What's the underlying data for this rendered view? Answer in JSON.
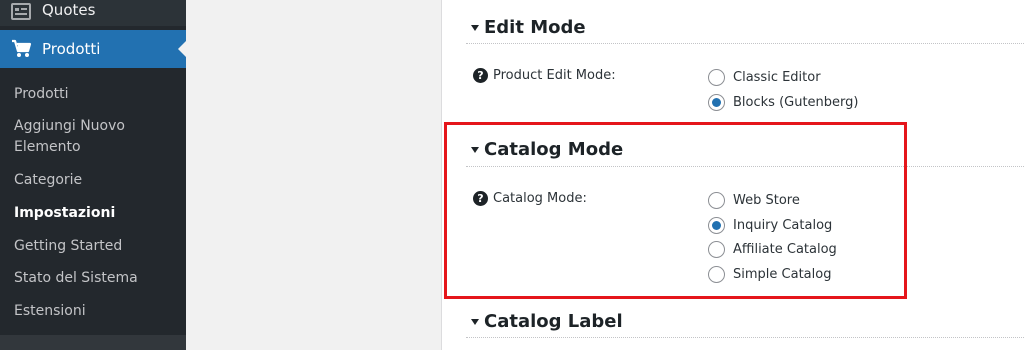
{
  "sidebar": {
    "quotes_label": "Quotes",
    "prodotti_label": "Prodotti",
    "submenu": [
      {
        "label": "Prodotti",
        "current": false
      },
      {
        "label": "Aggiungi Nuovo\nElemento",
        "current": false
      },
      {
        "label": "Categorie",
        "current": false
      },
      {
        "label": "Impostazioni",
        "current": true
      },
      {
        "label": "Getting Started",
        "current": false
      },
      {
        "label": "Stato del Sistema",
        "current": false
      },
      {
        "label": "Estensioni",
        "current": false
      }
    ]
  },
  "sections": {
    "edit_mode": {
      "title": "Edit Mode",
      "field_label": "Product Edit Mode:",
      "options": [
        "Classic Editor",
        "Blocks (Gutenberg)"
      ],
      "selected": "Blocks (Gutenberg)"
    },
    "catalog_mode": {
      "title": "Catalog Mode",
      "field_label": "Catalog Mode:",
      "options": [
        "Web Store",
        "Inquiry Catalog",
        "Affiliate Catalog",
        "Simple Catalog"
      ],
      "selected": "Inquiry Catalog"
    },
    "catalog_label": {
      "title": "Catalog Label"
    }
  },
  "help_glyph": "?",
  "colors": {
    "sidebar_bg": "#23282d",
    "active_menu": "#2271b1",
    "radio_checked": "#2271b1",
    "highlight": "#e5161b"
  }
}
